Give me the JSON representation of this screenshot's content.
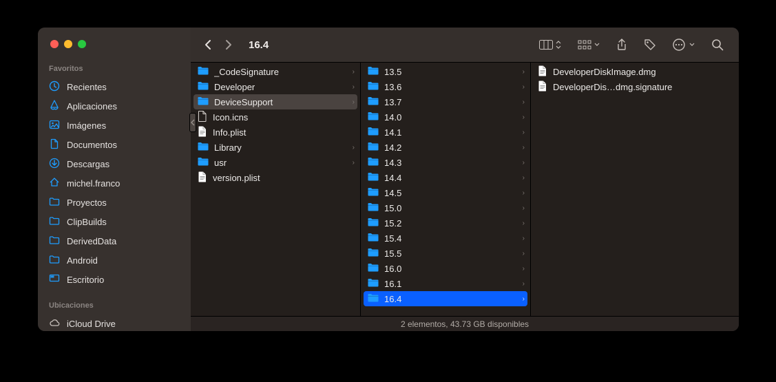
{
  "window_title": "16.4",
  "sidebar": {
    "sections": [
      {
        "title": "Favoritos",
        "items": [
          {
            "icon": "clock",
            "label": "Recientes"
          },
          {
            "icon": "apps",
            "label": "Aplicaciones"
          },
          {
            "icon": "image",
            "label": "Imágenes"
          },
          {
            "icon": "doc",
            "label": "Documentos"
          },
          {
            "icon": "download",
            "label": "Descargas"
          },
          {
            "icon": "home",
            "label": "michel.franco"
          },
          {
            "icon": "folder",
            "label": "Proyectos"
          },
          {
            "icon": "folder",
            "label": "ClipBuilds"
          },
          {
            "icon": "folder",
            "label": "DerivedData"
          },
          {
            "icon": "folder",
            "label": "Android"
          },
          {
            "icon": "desktop",
            "label": "Escritorio"
          }
        ]
      },
      {
        "title": "Ubicaciones",
        "items": [
          {
            "icon": "cloud",
            "label": "iCloud Drive"
          }
        ]
      }
    ]
  },
  "columns": [
    {
      "selected_index": 2,
      "items": [
        {
          "type": "folder",
          "name": "_CodeSignature",
          "arrow": true
        },
        {
          "type": "folder",
          "name": "Developer",
          "arrow": true
        },
        {
          "type": "folder",
          "name": "DeviceSupport",
          "arrow": true
        },
        {
          "type": "file",
          "name": "Icon.icns",
          "arrow": false
        },
        {
          "type": "doc",
          "name": "Info.plist",
          "arrow": false
        },
        {
          "type": "folder",
          "name": "Library",
          "arrow": true
        },
        {
          "type": "folder",
          "name": "usr",
          "arrow": true
        },
        {
          "type": "doc",
          "name": "version.plist",
          "arrow": false
        }
      ]
    },
    {
      "selected_index": 15,
      "items": [
        {
          "type": "folder",
          "name": "13.5",
          "arrow": true
        },
        {
          "type": "folder",
          "name": "13.6",
          "arrow": true
        },
        {
          "type": "folder",
          "name": "13.7",
          "arrow": true
        },
        {
          "type": "folder",
          "name": "14.0",
          "arrow": true
        },
        {
          "type": "folder",
          "name": "14.1",
          "arrow": true
        },
        {
          "type": "folder",
          "name": "14.2",
          "arrow": true
        },
        {
          "type": "folder",
          "name": "14.3",
          "arrow": true
        },
        {
          "type": "folder",
          "name": "14.4",
          "arrow": true
        },
        {
          "type": "folder",
          "name": "14.5",
          "arrow": true
        },
        {
          "type": "folder",
          "name": "15.0",
          "arrow": true
        },
        {
          "type": "folder",
          "name": "15.2",
          "arrow": true
        },
        {
          "type": "folder",
          "name": "15.4",
          "arrow": true
        },
        {
          "type": "folder",
          "name": "15.5",
          "arrow": true
        },
        {
          "type": "folder",
          "name": "16.0",
          "arrow": true
        },
        {
          "type": "folder",
          "name": "16.1",
          "arrow": true
        },
        {
          "type": "folder",
          "name": "16.4",
          "arrow": true
        }
      ]
    },
    {
      "selected_index": -1,
      "items": [
        {
          "type": "doc",
          "name": "DeveloperDiskImage.dmg",
          "arrow": false
        },
        {
          "type": "doc",
          "name": "DeveloperDis…dmg.signature",
          "arrow": false
        }
      ]
    }
  ],
  "status_bar": "2 elementos, 43.73 GB disponibles",
  "colors": {
    "folder": "#1e9dff",
    "accent": "#0a60ff",
    "sidebar_icon": "#1e9dff"
  }
}
